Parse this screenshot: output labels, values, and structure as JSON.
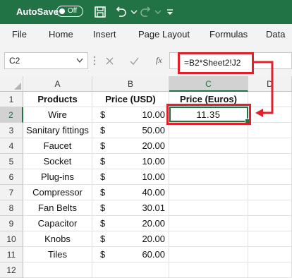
{
  "titlebar": {
    "autosave_label": "AutoSave",
    "toggle_state": "Off",
    "icons": [
      "save-icon",
      "undo-icon",
      "redo-icon",
      "customize-toolbar-icon"
    ]
  },
  "menu": {
    "items": [
      "File",
      "Home",
      "Insert",
      "Page Layout",
      "Formulas",
      "Data"
    ]
  },
  "formula_bar": {
    "name_box": "C2",
    "formula": "=B2*Sheet2!J2",
    "fx_label": "fx"
  },
  "sheet": {
    "columns": [
      "A",
      "B",
      "C",
      "D"
    ],
    "rows": [
      "1",
      "2",
      "3",
      "4",
      "5",
      "6",
      "7",
      "8",
      "9",
      "10",
      "11",
      "12"
    ],
    "headers": {
      "products": "Products",
      "price_usd": "Price (USD)",
      "price_euros": "Price (Euros)"
    },
    "data": [
      {
        "product": "Wire",
        "currency": "$",
        "price": "10.00",
        "euro": "11.35"
      },
      {
        "product": "Sanitary fittings",
        "currency": "$",
        "price": "50.00",
        "euro": ""
      },
      {
        "product": "Faucet",
        "currency": "$",
        "price": "20.00",
        "euro": ""
      },
      {
        "product": "Socket",
        "currency": "$",
        "price": "10.00",
        "euro": ""
      },
      {
        "product": "Plug-ins",
        "currency": "$",
        "price": "10.00",
        "euro": ""
      },
      {
        "product": "Compressor",
        "currency": "$",
        "price": "40.00",
        "euro": ""
      },
      {
        "product": "Fan Belts",
        "currency": "$",
        "price": "30.01",
        "euro": ""
      },
      {
        "product": "Capacitor",
        "currency": "$",
        "price": "20.00",
        "euro": ""
      },
      {
        "product": "Knobs",
        "currency": "$",
        "price": "20.00",
        "euro": ""
      },
      {
        "product": "Tiles",
        "currency": "$",
        "price": "60.00",
        "euro": ""
      }
    ]
  },
  "colors": {
    "excel_green": "#217346",
    "highlight_red": "#e0202b"
  }
}
